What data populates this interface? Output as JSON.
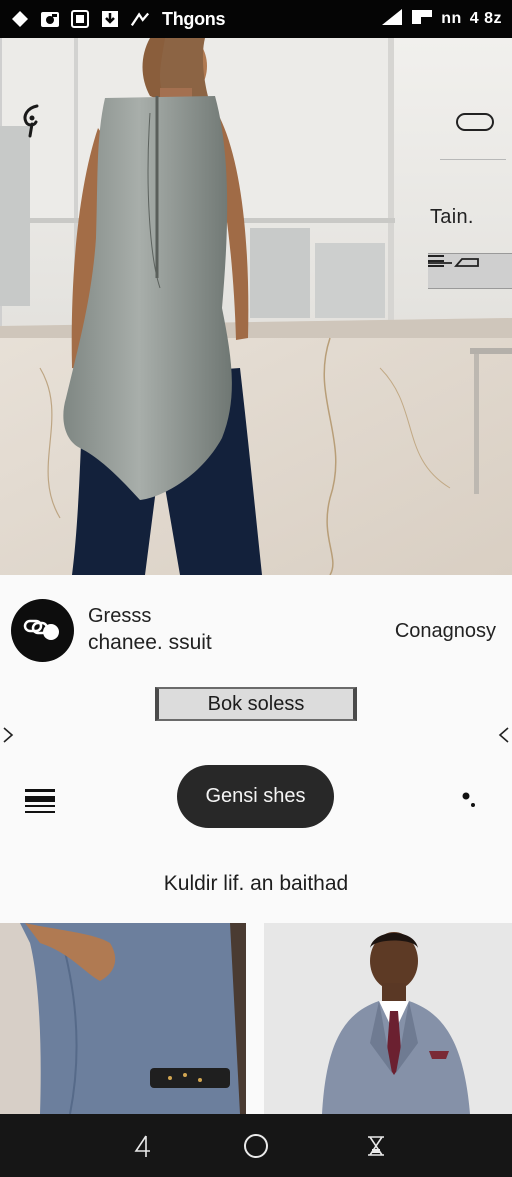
{
  "status_bar": {
    "app_name": "Thgons",
    "carrier": "nn",
    "time": "4 8z",
    "icons": [
      "diamond-icon",
      "camera-icon",
      "gallery-icon",
      "download-icon",
      "wave-icon",
      "signal-icon",
      "battery-icon"
    ]
  },
  "hero": {
    "label": "Tain.",
    "brand_icon": "brand-logo-icon",
    "menu_icon": "pill-icon",
    "toolbar_icons": [
      "list-icon",
      "stroke-icon"
    ]
  },
  "profile": {
    "name": "Gresss",
    "subtitle": "chanee. ssuit",
    "link": "Conagnosy",
    "avatar_icon": "link-icon"
  },
  "book_button": {
    "label": "Bok soless"
  },
  "genre_button": {
    "label": "Gensi shes"
  },
  "section": {
    "title": "Kuldir lif. an baithad"
  },
  "nav": {
    "icons": [
      "back-icon",
      "home-icon",
      "recents-icon"
    ]
  },
  "colors": {
    "status_bar": "#050505",
    "nav_bar": "#161616",
    "pill_button": "#282828",
    "background": "#fafafa"
  }
}
